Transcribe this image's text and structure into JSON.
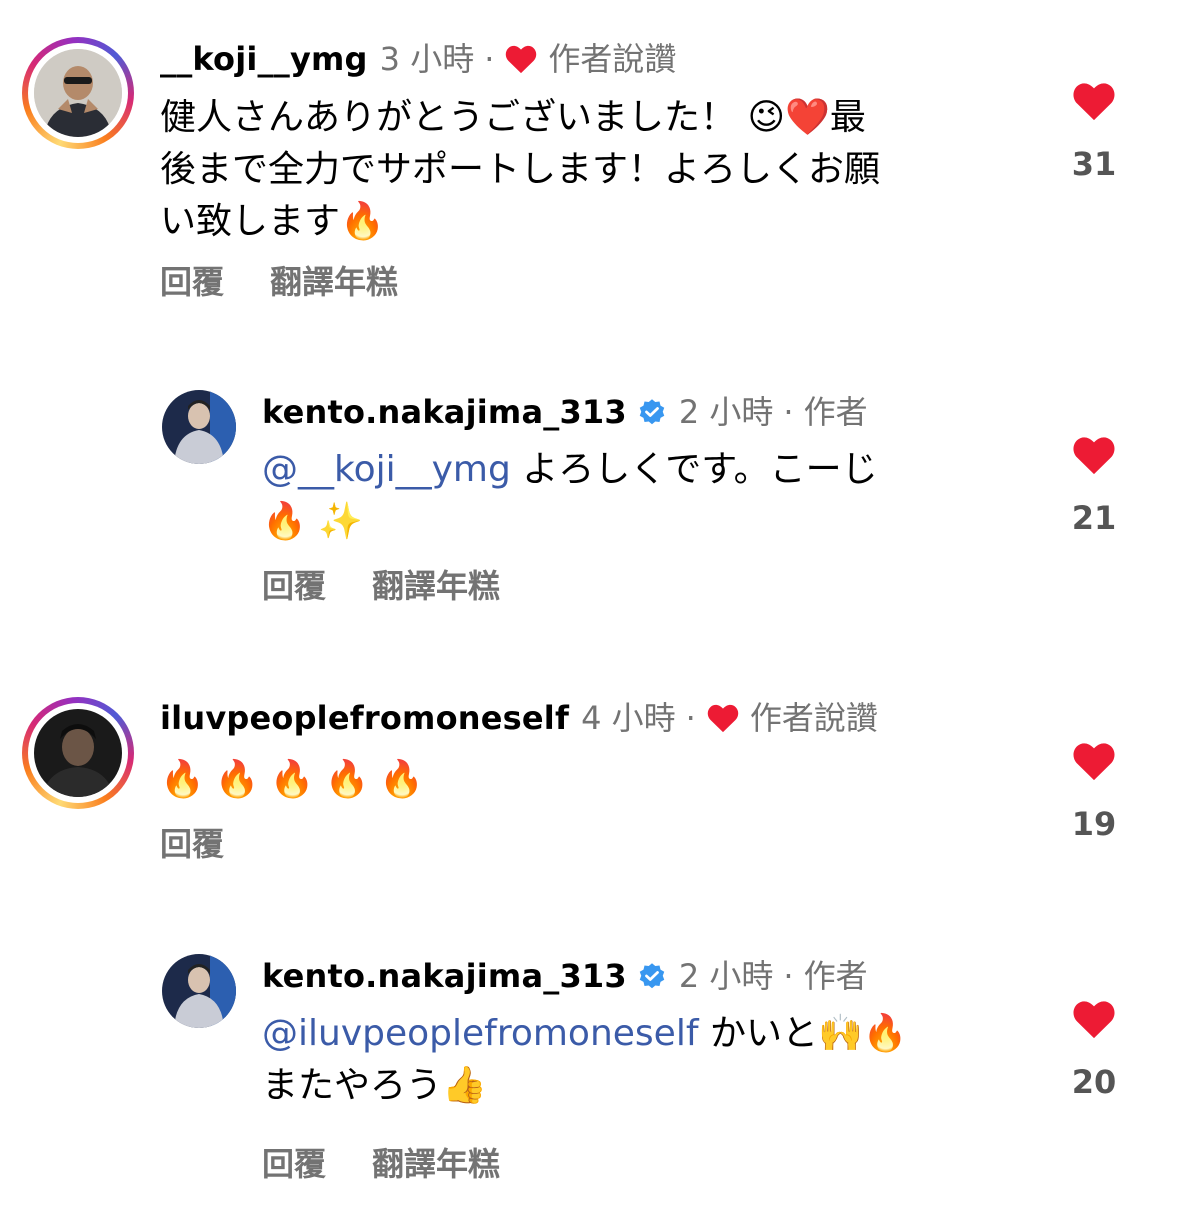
{
  "comments": [
    {
      "username": "__koji__ymg",
      "time": "3 小時",
      "liked_by_author": "作者說讚",
      "line1": "健人さんありがとうございました！",
      "line1_emoji": "😉❤️",
      "line1_tail": "最",
      "line2": "後まで全力でサポートします！よろしくお願",
      "line3": "い致します",
      "line3_emoji": "🔥",
      "reply_label": "回覆",
      "translate_label": "翻譯年糕",
      "likes": "31"
    },
    {
      "username": "kento.nakajima_313",
      "time": "2 小時",
      "author_label": "作者",
      "mention": "@__koji__ymg",
      "line1": " よろしくです。こーじ",
      "line2_emoji": "🔥 ✨",
      "reply_label": "回覆",
      "translate_label": "翻譯年糕",
      "likes": "21"
    },
    {
      "username": "iluvpeoplefromoneself",
      "time": "4 小時",
      "liked_by_author": "作者說讚",
      "line1_emoji": "🔥🔥🔥🔥🔥",
      "reply_label": "回覆",
      "likes": "19"
    },
    {
      "username": "kento.nakajima_313",
      "time": "2 小時",
      "author_label": "作者",
      "mention": "@iluvpeoplefromoneself",
      "line1": " かいと",
      "line1_emoji": "🙌🔥",
      "line2": "またやろう",
      "line2_emoji": "👍",
      "reply_label": "回覆",
      "translate_label": "翻譯年糕",
      "likes": "20"
    }
  ],
  "icons": {
    "like": "heart-icon",
    "verified": "verified-badge-icon"
  },
  "colors": {
    "heart_red": "#ed1b34",
    "secondary_text": "#737373",
    "mention_blue": "#3b5ba8",
    "verified_blue": "#3897f0"
  }
}
